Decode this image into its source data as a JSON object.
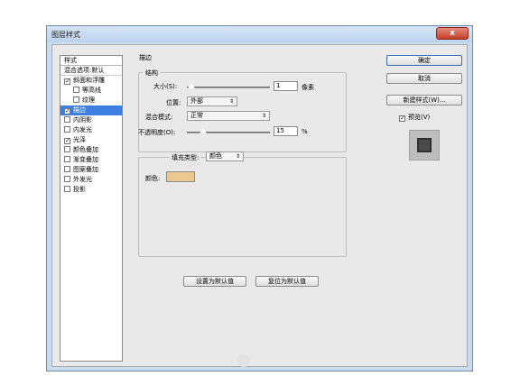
{
  "window": {
    "title": "图层样式",
    "close_glyph": "x"
  },
  "style_list": {
    "header": "样式",
    "blend_options": "混合选项:默认",
    "items": [
      {
        "label": "斜面和浮雕",
        "checked": true,
        "indent": false,
        "selected": false
      },
      {
        "label": "等高线",
        "checked": false,
        "indent": true,
        "selected": false
      },
      {
        "label": "纹理",
        "checked": false,
        "indent": true,
        "selected": false
      },
      {
        "label": "描边",
        "checked": true,
        "indent": false,
        "selected": true
      },
      {
        "label": "内阴影",
        "checked": false,
        "indent": false,
        "selected": false
      },
      {
        "label": "内发光",
        "checked": false,
        "indent": false,
        "selected": false
      },
      {
        "label": "光泽",
        "checked": true,
        "indent": false,
        "selected": false
      },
      {
        "label": "颜色叠加",
        "checked": false,
        "indent": false,
        "selected": false
      },
      {
        "label": "渐变叠加",
        "checked": false,
        "indent": false,
        "selected": false
      },
      {
        "label": "图案叠加",
        "checked": false,
        "indent": false,
        "selected": false
      },
      {
        "label": "外发光",
        "checked": false,
        "indent": false,
        "selected": false
      },
      {
        "label": "投影",
        "checked": false,
        "indent": false,
        "selected": false
      }
    ]
  },
  "stroke": {
    "section_title": "描边",
    "structure_title": "结构",
    "size_label": "大小(S):",
    "size_value": "1",
    "size_unit": "像素",
    "size_slider_level": 0.01,
    "position_label": "位置:",
    "position_value": "外部",
    "blend_label": "混合模式:",
    "blend_value": "正常",
    "opacity_label": "不透明度(O):",
    "opacity_value": "15",
    "opacity_unit": "%",
    "opacity_slider_level": 0.15,
    "fill_type_label": "填充类型:",
    "fill_type_value": "颜色",
    "color_label": "颜色:",
    "color_value": "#e9c98f"
  },
  "buttons": {
    "make_default": "设置为默认值",
    "reset_default": "复位为默认值",
    "ok": "确定",
    "cancel": "取消",
    "new_style": "新建样式(W)...",
    "preview": "预览(V)",
    "preview_checked": true
  },
  "colors": {
    "title_bar": "#c9dbef",
    "selection": "#3d7fe0",
    "close": "#c4402b"
  }
}
